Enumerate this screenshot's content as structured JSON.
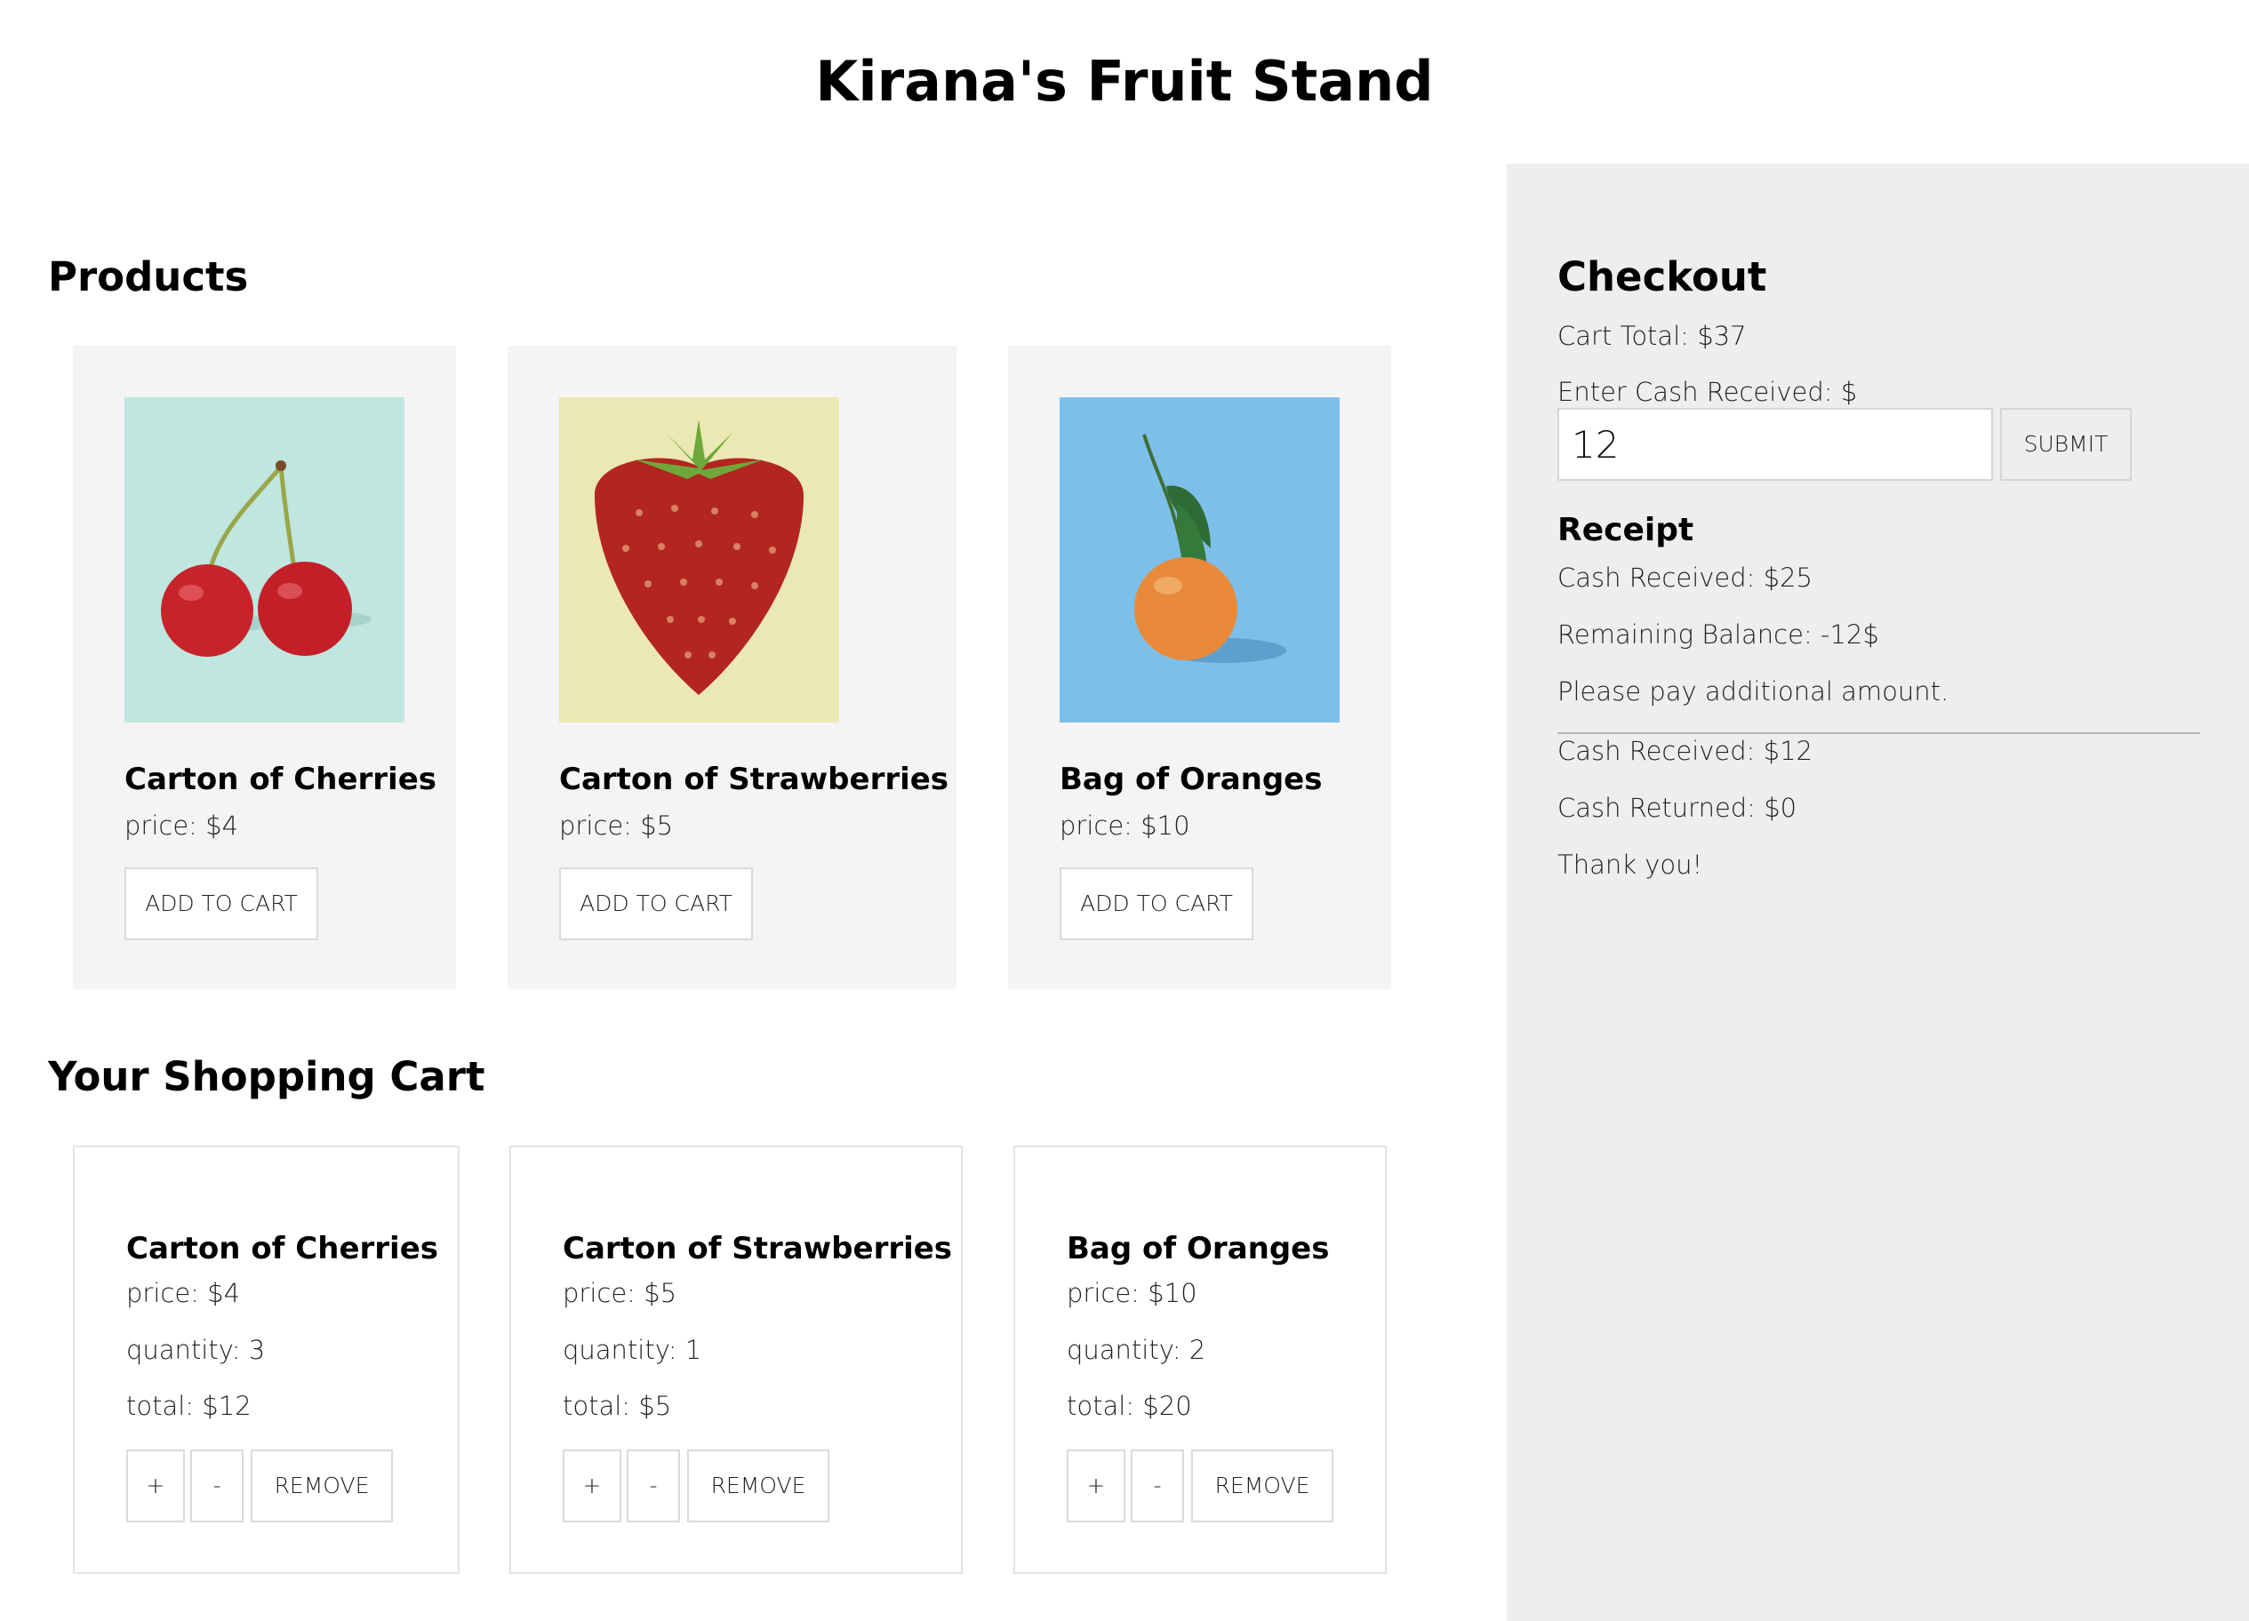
{
  "header": {
    "title": "Kirana's Fruit Stand"
  },
  "products": {
    "heading": "Products",
    "items": [
      {
        "name": "Carton of Cherries",
        "price": "price: $4",
        "button": "ADD TO CART",
        "image_bg": "#bfe6df",
        "image": "cherries"
      },
      {
        "name": "Carton of Strawberries",
        "price": "price: $5",
        "button": "ADD TO CART",
        "image_bg": "#ebe8b3",
        "image": "strawberry"
      },
      {
        "name": "Bag of Oranges",
        "price": "price: $10",
        "button": "ADD TO CART",
        "image_bg": "#7ebfea",
        "image": "orange"
      }
    ]
  },
  "cart": {
    "heading": "Your Shopping Cart",
    "items": [
      {
        "name": "Carton of Cherries",
        "price": "price: $4",
        "quantity": "quantity: 3",
        "total": "total: $12",
        "plus": "+",
        "minus": "-",
        "remove": "REMOVE"
      },
      {
        "name": "Carton of Strawberries",
        "price": "price: $5",
        "quantity": "quantity: 1",
        "total": "total: $5",
        "plus": "+",
        "minus": "-",
        "remove": "REMOVE"
      },
      {
        "name": "Bag of Oranges",
        "price": "price: $10",
        "quantity": "quantity: 2",
        "total": "total: $20",
        "plus": "+",
        "minus": "-",
        "remove": "REMOVE"
      }
    ]
  },
  "checkout": {
    "heading": "Checkout",
    "cart_total": "Cart Total: $37",
    "cash_label": "Enter Cash Received: $",
    "cash_value": "12",
    "submit": "SUBMIT",
    "receipt_heading": "Receipt",
    "receipt_lines": [
      "Cash Received: $25",
      "Remaining Balance: -12$",
      "Please pay additional amount.",
      "Cash Received: $12",
      "Cash Returned: $0",
      "Thank you!"
    ]
  },
  "colors": {
    "checkout_bg": "#eeeeee",
    "product_card_bg": "#f4f4f4",
    "cherry_red": "#c8232b",
    "strawberry_red": "#b32520",
    "orange": "#e88a3a"
  }
}
